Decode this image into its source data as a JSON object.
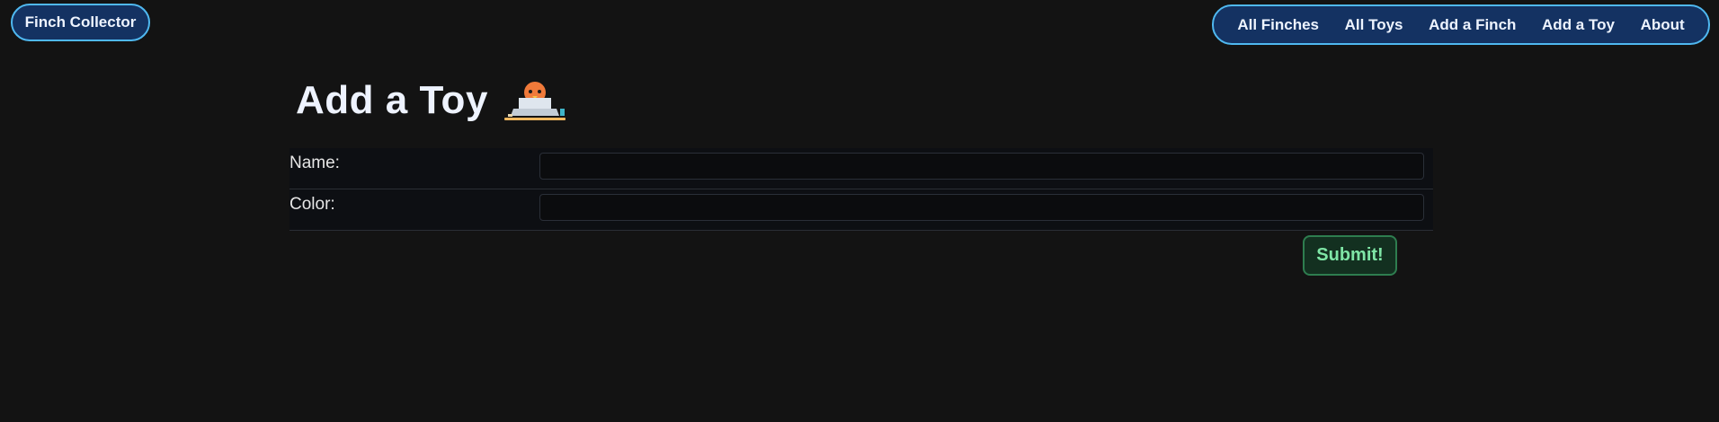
{
  "brand": {
    "label": "Finch Collector"
  },
  "nav": {
    "items": [
      {
        "label": "All Finches"
      },
      {
        "label": "All Toys"
      },
      {
        "label": "Add a Finch"
      },
      {
        "label": "Add a Toy"
      },
      {
        "label": "About"
      }
    ]
  },
  "page": {
    "title": "Add a Toy",
    "mascot_icon": "finch-at-laptop-icon"
  },
  "form": {
    "fields": [
      {
        "label": "Name:",
        "value": "",
        "placeholder": ""
      },
      {
        "label": "Color:",
        "value": "",
        "placeholder": ""
      }
    ],
    "submit_label": "Submit!"
  },
  "colors": {
    "background": "#131313",
    "nav_bg": "#143262",
    "nav_border": "#4fb8f0",
    "submit_text": "#7fe6a6",
    "submit_border": "#2e7d4f"
  }
}
